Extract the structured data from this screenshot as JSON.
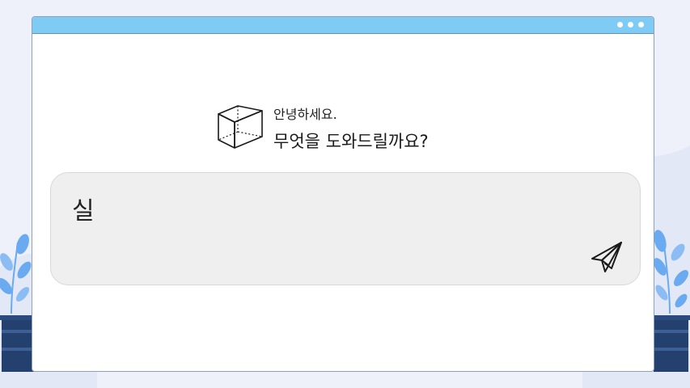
{
  "greeting": {
    "line1": "안녕하세요.",
    "line2": "무엇을 도와드릴까요?"
  },
  "prompt": {
    "text": "실"
  },
  "icons": {
    "cube": "cube-icon",
    "send": "paper-plane-icon",
    "plants": "potted-plant-illustration"
  },
  "colors": {
    "titlebar": "#7ecbf6",
    "window_background": "#ffffff",
    "prompt_background": "#efeff0",
    "page_background": "#eef1fa",
    "plant_leaf": "#6aaaf0",
    "pot": "#23406f"
  }
}
